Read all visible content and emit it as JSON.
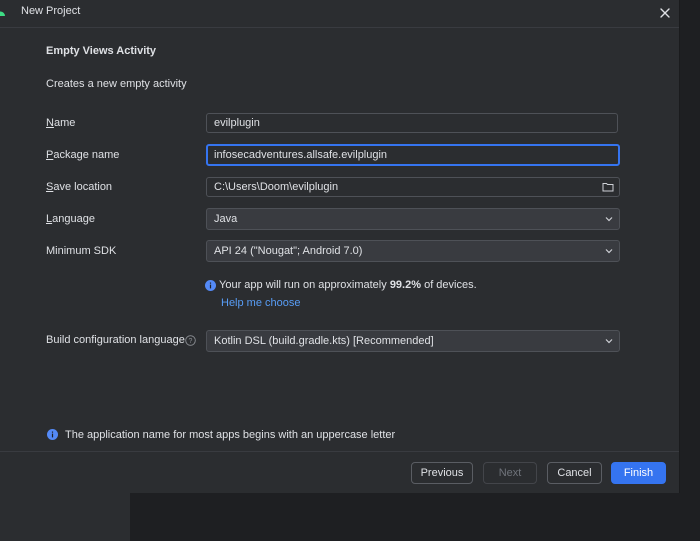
{
  "window": {
    "title": "New Project"
  },
  "header": {
    "heading": "Empty Views Activity",
    "description": "Creates a new empty activity"
  },
  "form": {
    "name": {
      "label_mnemonic": "N",
      "label_rest": "ame",
      "value": "evilplugin"
    },
    "package": {
      "label_mnemonic": "P",
      "label_rest": "ackage name",
      "value": "infosecadventures.allsafe.evilplugin"
    },
    "save_location": {
      "label_mnemonic": "S",
      "label_rest": "ave location",
      "value": "C:\\Users\\Doom\\evilplugin"
    },
    "language": {
      "label_mnemonic": "L",
      "label_rest": "anguage",
      "value": "Java"
    },
    "min_sdk": {
      "label": "Minimum SDK",
      "value": "API 24 (\"Nougat\"; Android 7.0)"
    },
    "sdk_info": {
      "prefix": "Your app will run on approximately ",
      "percent": "99.2%",
      "suffix": " of devices."
    },
    "help_link": "Help me choose",
    "build_lang": {
      "label": "Build configuration language",
      "value": "Kotlin DSL (build.gradle.kts) [Recommended]"
    }
  },
  "warning": "The application name for most apps begins with an uppercase letter",
  "buttons": {
    "previous": "Previous",
    "next": "Next",
    "cancel": "Cancel",
    "finish": "Finish"
  },
  "colors": {
    "accent": "#3574f0",
    "link": "#589df6",
    "info": "#548af7",
    "background": "#2b2d30"
  },
  "icons": [
    "android-icon",
    "close-icon",
    "folder-icon",
    "chevron-down-icon",
    "info-icon",
    "question-icon"
  ]
}
